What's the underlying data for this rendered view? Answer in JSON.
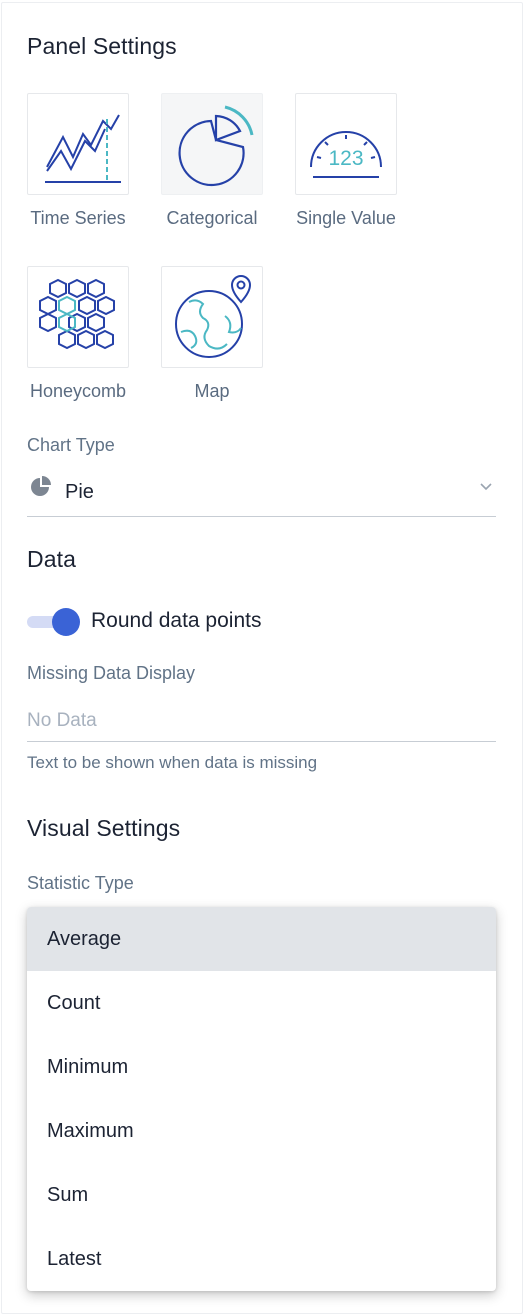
{
  "panel_settings": {
    "title": "Panel Settings",
    "types": [
      {
        "label": "Time Series",
        "icon": "time-series-icon",
        "selected": false
      },
      {
        "label": "Categorical",
        "icon": "categorical-icon",
        "selected": true
      },
      {
        "label": "Single Value",
        "icon": "single-value-icon",
        "selected": false
      },
      {
        "label": "Honeycomb",
        "icon": "honeycomb-icon",
        "selected": false
      },
      {
        "label": "Map",
        "icon": "map-icon",
        "selected": false
      }
    ],
    "single_value_icon_text": "123",
    "chart_type": {
      "label": "Chart Type",
      "value": "Pie",
      "icon": "pie-icon"
    }
  },
  "data_section": {
    "title": "Data",
    "round_toggle": {
      "label": "Round data points",
      "on": true
    },
    "missing_display": {
      "label": "Missing Data Display",
      "value": "",
      "placeholder": "No Data",
      "helper": "Text to be shown when data is missing"
    }
  },
  "visual_settings": {
    "title": "Visual Settings",
    "statistic_type": {
      "label": "Statistic Type",
      "options": [
        "Average",
        "Count",
        "Minimum",
        "Maximum",
        "Sum",
        "Latest"
      ],
      "highlighted": "Average"
    }
  },
  "colors": {
    "accent": "#3a63d6",
    "icon_blue": "#2541a8",
    "icon_teal": "#4bb8c4",
    "text": "#1c2333",
    "muted": "#617387"
  }
}
